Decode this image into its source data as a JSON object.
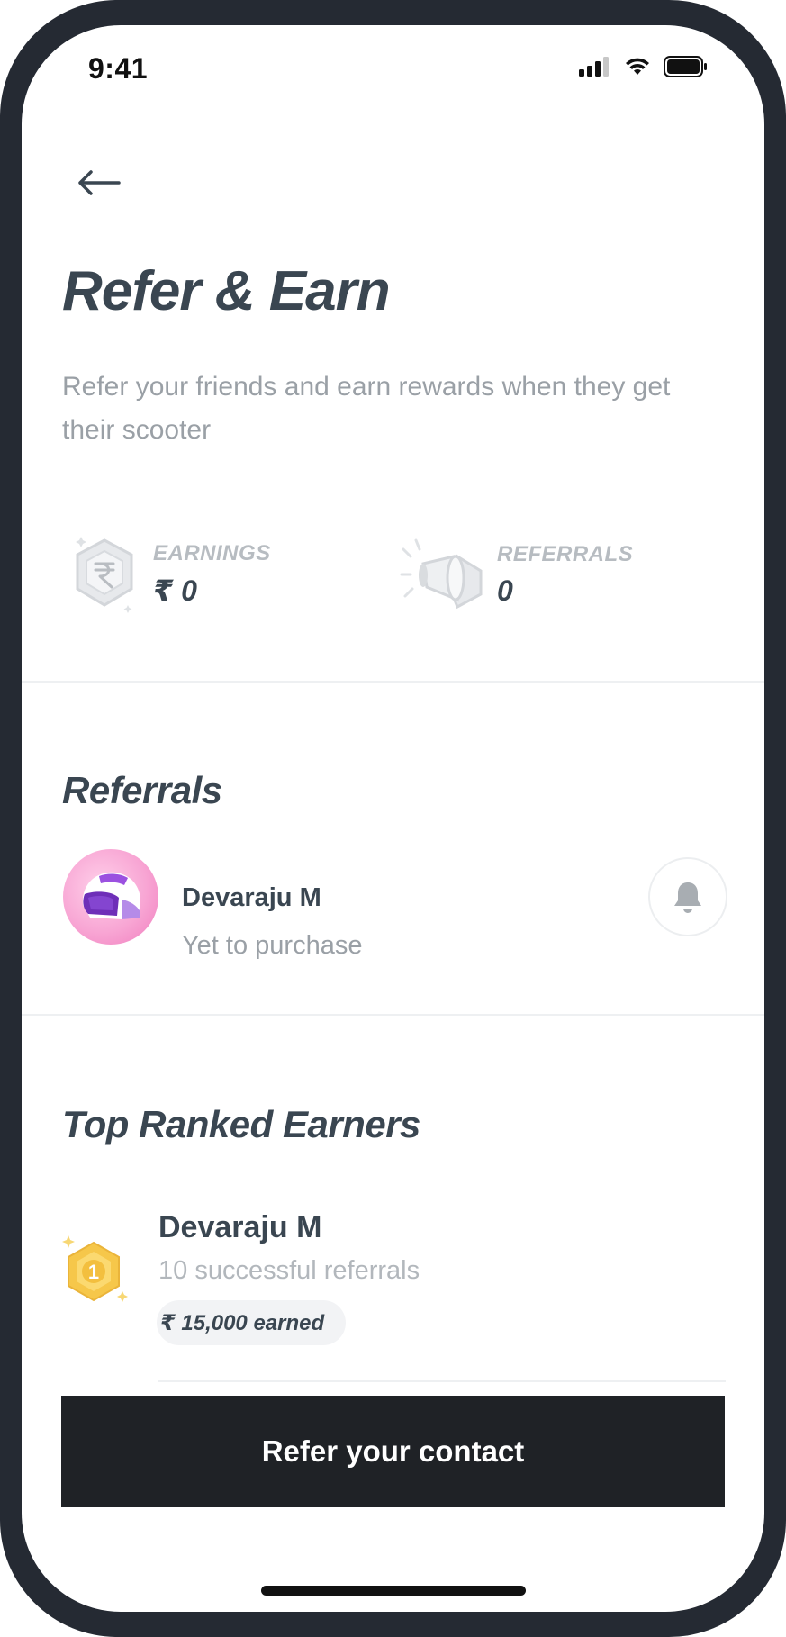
{
  "status_bar": {
    "time": "9:41"
  },
  "header": {
    "title": "Refer & Earn",
    "subtitle": "Refer your friends and earn rewards when they get their scooter"
  },
  "stats": {
    "earnings": {
      "label": "EARNINGS",
      "value": "₹ 0",
      "icon": "rupee-coin-icon"
    },
    "referrals": {
      "label": "REFERRALS",
      "value": "0",
      "icon": "megaphone-icon"
    }
  },
  "referrals_section": {
    "title": "Referrals",
    "items": [
      {
        "name": "Devaraju M",
        "status": "Yet to purchase",
        "avatar": "helmet-avatar",
        "action_icon": "bell-icon"
      }
    ]
  },
  "top_earners_section": {
    "title": "Top Ranked Earners",
    "items": [
      {
        "rank": "1",
        "name": "Devaraju M",
        "referrals": "10 successful referrals",
        "earned": "₹ 15,000 earned",
        "badge_icon": "gold-rank-badge-icon"
      }
    ]
  },
  "cta": {
    "label": "Refer your contact"
  },
  "colors": {
    "title": "#3a4651",
    "muted": "#9aa0a6",
    "cta_bg": "#1f2226",
    "gold": "#f6c74a",
    "avatar_pink": "#f8a6d4"
  }
}
